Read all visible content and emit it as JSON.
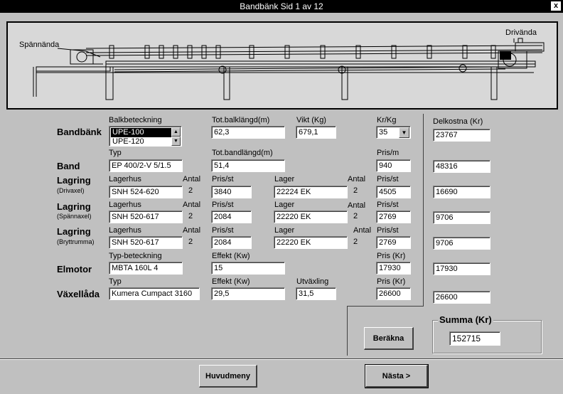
{
  "window": {
    "title": "Bandbänk  Sid 1 av 12",
    "close": "x"
  },
  "drawing": {
    "left_label": "Spännända",
    "right_label": "Drivända"
  },
  "headers": {
    "balkbeteckning": "Balkbeteckning",
    "tot_balklangd": "Tot.balklängd(m)",
    "vikt": "Vikt (Kg)",
    "kr_kg": "Kr/Kg",
    "delkostna": "Delkostna (Kr)",
    "typ": "Typ",
    "tot_bandlangd": "Tot.bandlängd(m)",
    "pris_m": "Pris/m",
    "lagerhus": "Lagerhus",
    "antal": "Antal",
    "pris_st": "Pris/st",
    "lager": "Lager",
    "typ_beteckning": "Typ-beteckning",
    "effekt": "Effekt (Kw)",
    "pris_kr": "Pris (Kr)",
    "utvaxling": "Utväxling"
  },
  "bandbank": {
    "label": "Bandbänk",
    "balk_options": [
      "UPE-100",
      "UPE-120"
    ],
    "balk_selected": "UPE-100",
    "tot_balklangd": "62,3",
    "vikt": "679,1",
    "kr_kg": "35",
    "delkostnad": "23767"
  },
  "band": {
    "label": "Band",
    "typ": "EP 400/2-V  5/1.5",
    "tot_bandlangd": "51,4",
    "pris_m": "940",
    "delkostnad": "48316"
  },
  "lagring_driv": {
    "label": "Lagring",
    "sublabel": "(Drivaxel)",
    "lagerhus": "SNH 524-620",
    "antal_hus": "2",
    "pris_hus": "3840",
    "lager": "22224 EK",
    "antal_lager": "2",
    "pris_lager": "4505",
    "delkostnad": "16690"
  },
  "lagring_spann": {
    "label": "Lagring",
    "sublabel": "(Spännaxel)",
    "lagerhus": "SNH 520-617",
    "antal_hus": "2",
    "pris_hus": "2084",
    "lager": "22220 EK",
    "antal_lager": "2",
    "pris_lager": "2769",
    "delkostnad": "9706"
  },
  "lagring_bryt": {
    "label": "Lagring",
    "sublabel": "(Bryttrumma)",
    "lagerhus": "SNH 520-617",
    "antal_hus": "2",
    "pris_hus": "2084",
    "lager": "22220 EK",
    "antal_lager": "2",
    "pris_lager": "2769",
    "delkostnad": "9706"
  },
  "elmotor": {
    "label": "Elmotor",
    "typ": "MBTA 160L 4",
    "effekt": "15",
    "pris": "17930",
    "delkostnad": "17930"
  },
  "vaxellada": {
    "label": "Växellåda",
    "typ": "Kumera Cumpact 3160",
    "effekt": "29,5",
    "utvaxling": "31,5",
    "pris": "26600",
    "delkostnad": "26600"
  },
  "summa": {
    "label": "Summa (Kr)",
    "value": "152715"
  },
  "buttons": {
    "berakna": "Beräkna",
    "huvudmeny": "Huvudmeny",
    "nasta": "Nästa >"
  }
}
